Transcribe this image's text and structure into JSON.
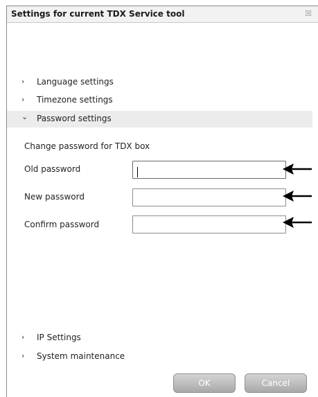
{
  "dialog": {
    "title": "Settings for current TDX Service tool",
    "close_glyph": "☒"
  },
  "sections": [
    {
      "label": "Language settings",
      "state": "collapsed",
      "icon": "chevron-right-icon"
    },
    {
      "label": "Timezone settings",
      "state": "collapsed",
      "icon": "chevron-right-icon"
    },
    {
      "label": "Password settings",
      "state": "expanded",
      "icon": "chevron-down-icon"
    }
  ],
  "password": {
    "heading": "Change password for TDX box",
    "old_label": "Old password",
    "new_label": "New password",
    "confirm_label": "Confirm password",
    "old_value": "",
    "new_value": "",
    "confirm_value": ""
  },
  "lower_sections": [
    {
      "label": "IP Settings",
      "state": "collapsed",
      "icon": "chevron-right-icon"
    },
    {
      "label": "System maintenance",
      "state": "collapsed",
      "icon": "chevron-right-icon"
    }
  ],
  "buttons": {
    "ok": "OK",
    "cancel": "Cancel"
  },
  "icons": {
    "collapsed": "›",
    "expanded": "⌄",
    "pointer_arrow": "pointer-arrow-icon"
  },
  "colors": {
    "button_top": "#d4d4d4",
    "button_bottom": "#a9a9a9",
    "expanded_row": "#ececec",
    "arrow": "#000000"
  }
}
